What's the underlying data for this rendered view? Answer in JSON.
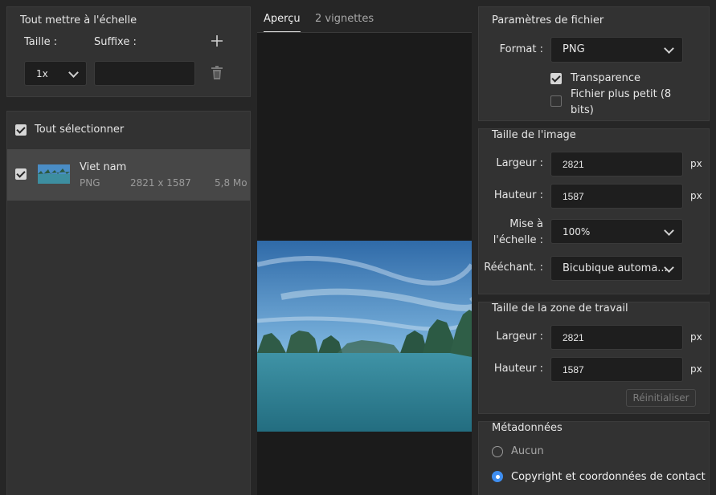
{
  "scale_panel": {
    "title": "Tout mettre à l'échelle",
    "size_label": "Taille :",
    "suffix_label": "Suffixe :",
    "size_value": "1x",
    "suffix_value": ""
  },
  "assets": {
    "select_all_label": "Tout sélectionner",
    "items": [
      {
        "name": "Viet nam",
        "format": "PNG",
        "dimensions": "2821 x 1587",
        "size": "5,8 Mo"
      }
    ]
  },
  "preview": {
    "tabs": [
      "Aperçu",
      "2 vignettes"
    ]
  },
  "file_settings": {
    "title": "Paramètres de fichier",
    "format_label": "Format :",
    "format_value": "PNG",
    "transparency_label": "Transparence",
    "smaller_file_label_1": "Fichier plus petit (8",
    "smaller_file_label_2": "bits)"
  },
  "image_size": {
    "title": "Taille de l'image",
    "width_label": "Largeur :",
    "width_value": "2821",
    "height_label": "Hauteur :",
    "height_value": "1587",
    "unit": "px",
    "scale_label_1": "Mise à",
    "scale_label_2": "l'échelle :",
    "scale_value": "100%",
    "resample_label": "Rééchant. :",
    "resample_value": "Bicubique automa..."
  },
  "canvas_size": {
    "title": "Taille de la zone de travail",
    "width_label": "Largeur :",
    "width_value": "2821",
    "height_label": "Hauteur :",
    "height_value": "1587",
    "unit": "px",
    "reset_label": "Réinitialiser"
  },
  "metadata": {
    "title": "Métadonnées",
    "option_none": "Aucun",
    "option_copyright": "Copyright et coordonnées de contact"
  }
}
